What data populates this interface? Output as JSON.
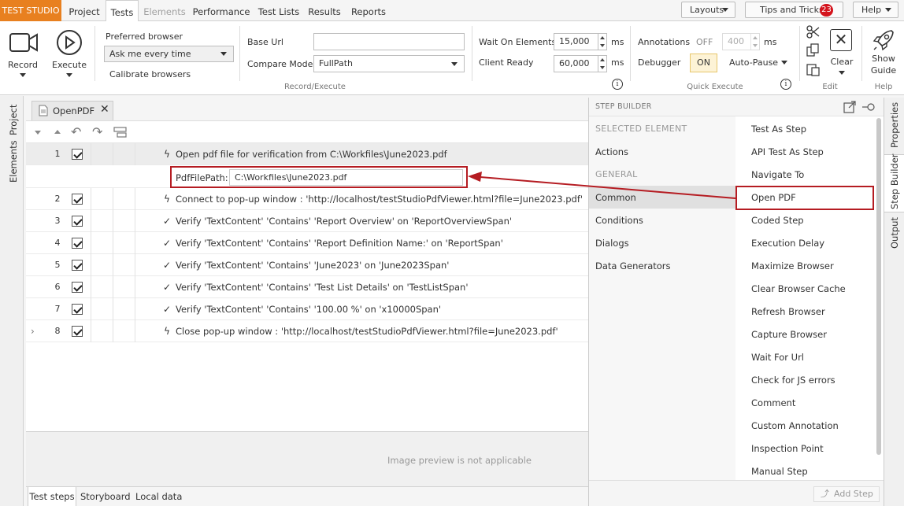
{
  "app_title": "TEST STUDIO",
  "main_tabs": [
    {
      "label": "Project",
      "state": "normal"
    },
    {
      "label": "Tests",
      "state": "active"
    },
    {
      "label": "Elements",
      "state": "disabled"
    },
    {
      "label": "Performance",
      "state": "normal"
    },
    {
      "label": "Test Lists",
      "state": "normal"
    },
    {
      "label": "Results",
      "state": "normal"
    },
    {
      "label": "Reports",
      "state": "normal"
    }
  ],
  "topbar": {
    "layouts": "Layouts",
    "tips": "Tips and Tricks",
    "tips_count": "23",
    "help": "Help"
  },
  "ribbon": {
    "record": "Record",
    "execute": "Execute",
    "preferred_browser_label": "Preferred browser",
    "preferred_browser_value": "Ask me every time",
    "calibrate": "Calibrate browsers",
    "base_url_label": "Base Url",
    "base_url_value": "",
    "compare_mode_label": "Compare Mode",
    "compare_mode_value": "FullPath",
    "wait_label": "Wait On Elements",
    "wait_value": "15,000",
    "client_ready_label": "Client Ready",
    "client_ready_value": "60,000",
    "ms": "ms",
    "annotations_label": "Annotations",
    "annotations_state": "OFF",
    "annotations_value": "400",
    "debugger_label": "Debugger",
    "debugger_state": "ON",
    "autopause": "Auto-Pause",
    "clear": "Clear",
    "show_guide_1": "Show",
    "show_guide_2": "Guide",
    "group_record_execute": "Record/Execute",
    "group_quick_execute": "Quick Execute",
    "group_edit": "Edit",
    "group_help": "Help"
  },
  "left_panel": {
    "project": "Project",
    "elements": "Elements"
  },
  "doc_tab": {
    "name": "OpenPDF"
  },
  "steps": [
    {
      "num": "1",
      "icon": "lightning",
      "text": "Open pdf file for verification from C:\\Workfiles\\June2023.pdf"
    },
    {
      "num": "2",
      "icon": "lightning",
      "text": "Connect to pop-up window : 'http://localhost/testStudioPdfViewer.html?file=June2023.pdf'"
    },
    {
      "num": "3",
      "icon": "check",
      "text": "Verify 'TextContent' 'Contains' 'Report Overview' on 'ReportOverviewSpan'"
    },
    {
      "num": "4",
      "icon": "check",
      "text": "Verify 'TextContent' 'Contains' 'Report Definition Name:' on 'ReportSpan'"
    },
    {
      "num": "5",
      "icon": "check",
      "text": "Verify 'TextContent' 'Contains' 'June2023' on 'June2023Span'"
    },
    {
      "num": "6",
      "icon": "check",
      "text": "Verify 'TextContent' 'Contains' 'Test List Details' on 'TestListSpan'"
    },
    {
      "num": "7",
      "icon": "check",
      "text": "Verify 'TextContent' 'Contains' '100.00 %' on 'x10000Span'"
    },
    {
      "num": "8",
      "icon": "lightning",
      "text": "Close pop-up window : 'http://localhost/testStudioPdfViewer.html?file=June2023.pdf'"
    }
  ],
  "param": {
    "label": "PdfFilePath:",
    "value": "C:\\Workfiles\\June2023.pdf"
  },
  "preview_text": "Image preview is not applicable",
  "bottom_tabs": [
    "Test steps",
    "Storyboard",
    "Local data"
  ],
  "step_builder": {
    "title": "STEP BUILDER",
    "categories": [
      {
        "label": "SELECTED ELEMENT",
        "header": true
      },
      {
        "label": "Actions"
      },
      {
        "label": "GENERAL",
        "header": true
      },
      {
        "label": "Common",
        "selected": true
      },
      {
        "label": "Conditions"
      },
      {
        "label": "Dialogs"
      },
      {
        "label": "Data Generators"
      }
    ],
    "items": [
      "Test As Step",
      "API Test As Step",
      "Navigate To",
      "Open PDF",
      "Coded Step",
      "Execution Delay",
      "Maximize Browser",
      "Clear Browser Cache",
      "Refresh Browser",
      "Capture Browser",
      "Wait For Url",
      "Check for JS errors",
      "Comment",
      "Custom Annotation",
      "Inspection Point",
      "Manual Step"
    ],
    "add_step": "Add Step"
  },
  "right_panel": {
    "properties": "Properties",
    "step_builder": "Step Builder",
    "output": "Output"
  },
  "colors": {
    "accent": "#e8801f",
    "callout": "#b51c22",
    "badge": "#d4141d"
  }
}
